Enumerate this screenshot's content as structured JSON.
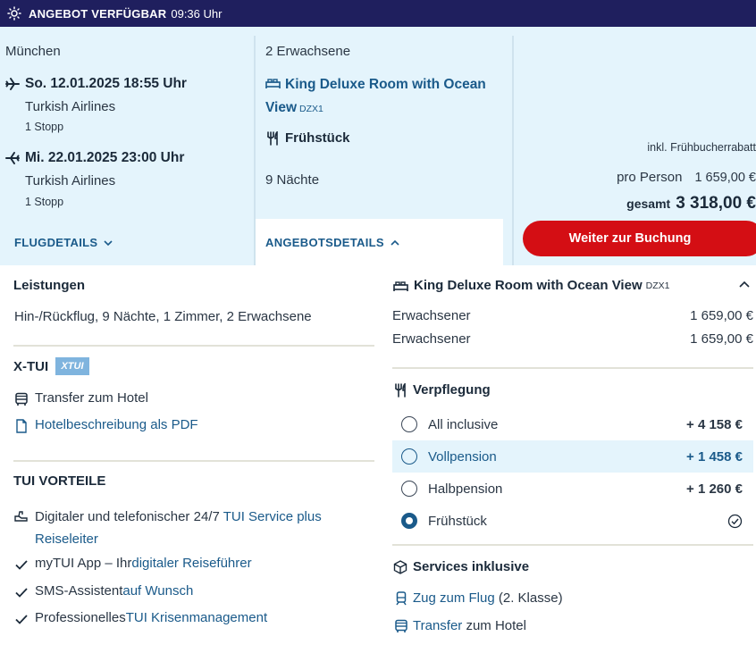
{
  "banner": {
    "title": "ANGEBOT VERFÜGBAR",
    "time": "09:36 Uhr",
    "icon": "sun-icon"
  },
  "flight": {
    "city": "München",
    "outbound": {
      "date": "So. 12.01.2025 18:55 Uhr",
      "airline": "Turkish Airlines",
      "stops": "1 Stopp"
    },
    "inbound": {
      "date": "Mi. 22.01.2025 23:00 Uhr",
      "airline": "Turkish Airlines",
      "stops": "1 Stopp"
    },
    "details_link": "FLUGDETAILS"
  },
  "offer": {
    "travellers": "2 Erwachsene",
    "room": "King Deluxe Room with Ocean View",
    "room_code": "DZX1",
    "board": "Frühstück",
    "nights": "9 Nächte",
    "details_link": "ANGEBOTSDETAILS"
  },
  "price": {
    "discount_note": "inkl. Frühbucherrabatt",
    "per_person_label": "pro Person",
    "per_person_value": "1 659,00 €",
    "total_label": "gesamt",
    "total_value": "3 318,00 €",
    "book_button": "Weiter zur Buchung"
  },
  "services": {
    "heading": "Leistungen",
    "summary": "Hin-/Rückflug, 9 Nächte, 1 Zimmer, 2 Erwachsene",
    "xtui_heading": "X-TUI",
    "xtui_badge": "XTUI",
    "transfer": "Transfer zum Hotel",
    "hotel_pdf": "Hotelbeschreibung als PDF"
  },
  "advantages": {
    "heading": "TUI VORTEILE",
    "items": [
      {
        "pre": "Digitaler und telefonischer 24/7 ",
        "link": "TUI Service plus Reiseleiter",
        "post": ""
      },
      {
        "pre": "myTUI App – Ihr ",
        "link": "digitaler Reiseführer",
        "post": ""
      },
      {
        "pre": "SMS-Assistent ",
        "link": "auf Wunsch",
        "post": ""
      },
      {
        "pre": "Professionelles ",
        "link": "TUI Krisenmanagement",
        "post": ""
      }
    ]
  },
  "room_prices": {
    "title": "King Deluxe Room with Ocean View",
    "code": "DZX1",
    "rows": [
      {
        "label": "Erwachsener",
        "value": "1 659,00 €"
      },
      {
        "label": "Erwachsener",
        "value": "1 659,00 €"
      }
    ]
  },
  "board_options": {
    "heading": "Verpflegung",
    "options": [
      {
        "label": "All inclusive",
        "price": "+ 4 158 €",
        "selected": false
      },
      {
        "label": "Vollpension",
        "price": "+ 1 458 €",
        "selected": false
      },
      {
        "label": "Halbpension",
        "price": "+ 1 260 €",
        "selected": false
      },
      {
        "label": "Frühstück",
        "price": "",
        "selected": true
      }
    ]
  },
  "included": {
    "heading": "Services inklusive",
    "train_link": "Zug zum Flug",
    "train_suffix": " (2. Klasse)",
    "transfer_link": "Transfer",
    "transfer_suffix": " zum Hotel"
  },
  "colors": {
    "navy": "#1f1f5e",
    "light_blue": "#e4f4fc",
    "link_blue": "#1a5a8a",
    "cta_red": "#d40e14"
  }
}
